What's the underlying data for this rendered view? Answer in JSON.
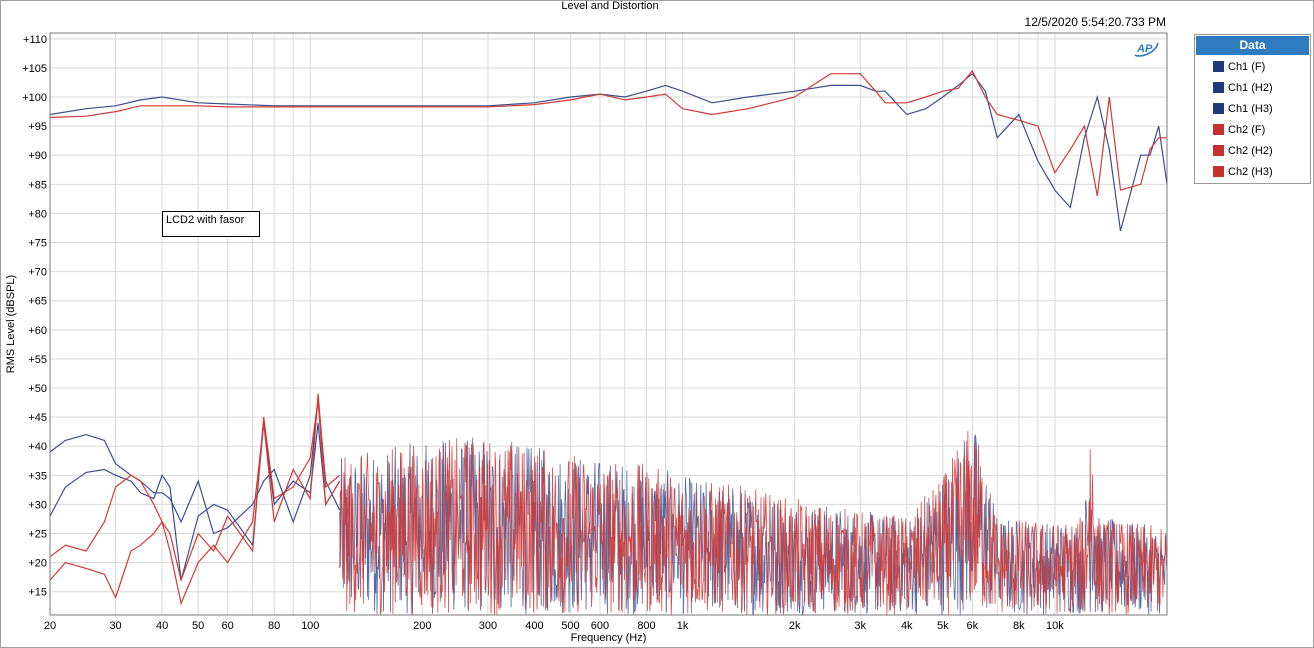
{
  "title": "Level and Distortion",
  "timestamp": "12/5/2020 5:54:20.733 PM",
  "logo_text": "AP",
  "annotation": "LCD2 with fasor",
  "legend": {
    "header": "Data",
    "items": [
      {
        "label": "Ch1 (F)",
        "color": "#1f3a7a"
      },
      {
        "label": "Ch1 (H2)",
        "color": "#1f3a7a"
      },
      {
        "label": "Ch1 (H3)",
        "color": "#1f3a7a"
      },
      {
        "label": "Ch2 (F)",
        "color": "#c8302e"
      },
      {
        "label": "Ch2 (H2)",
        "color": "#c8302e"
      },
      {
        "label": "Ch2 (H3)",
        "color": "#c8302e"
      }
    ]
  },
  "colors": {
    "ch1": "#3b4f8f",
    "ch2": "#d03a37",
    "grid": "#d8d8d8",
    "accent": "#2e7cbf"
  },
  "chart_data": {
    "type": "line",
    "xlabel": "Frequency (Hz)",
    "ylabel": "RMS Level (dBSPL)",
    "x_scale": "log",
    "xlim": [
      20,
      20000
    ],
    "ylim": [
      11,
      111
    ],
    "grid": true,
    "legend_position": "right",
    "x_ticks": [
      {
        "v": 20,
        "label": "20"
      },
      {
        "v": 30,
        "label": "30"
      },
      {
        "v": 40,
        "label": "40"
      },
      {
        "v": 50,
        "label": "50"
      },
      {
        "v": 60,
        "label": "60"
      },
      {
        "v": 80,
        "label": "80"
      },
      {
        "v": 100,
        "label": "100"
      },
      {
        "v": 200,
        "label": "200"
      },
      {
        "v": 300,
        "label": "300"
      },
      {
        "v": 400,
        "label": "400"
      },
      {
        "v": 500,
        "label": "500"
      },
      {
        "v": 600,
        "label": "600"
      },
      {
        "v": 800,
        "label": "800"
      },
      {
        "v": 1000,
        "label": "1k"
      },
      {
        "v": 2000,
        "label": "2k"
      },
      {
        "v": 3000,
        "label": "3k"
      },
      {
        "v": 4000,
        "label": "4k"
      },
      {
        "v": 5000,
        "label": "5k"
      },
      {
        "v": 6000,
        "label": "6k"
      },
      {
        "v": 8000,
        "label": "8k"
      },
      {
        "v": 10000,
        "label": "10k"
      }
    ],
    "y_ticks": [
      {
        "v": 110,
        "label": "+110"
      },
      {
        "v": 105,
        "label": "+105"
      },
      {
        "v": 100,
        "label": "+100"
      },
      {
        "v": 95,
        "label": "+95"
      },
      {
        "v": 90,
        "label": "+90"
      },
      {
        "v": 85,
        "label": "+85"
      },
      {
        "v": 80,
        "label": "+80"
      },
      {
        "v": 75,
        "label": "+75"
      },
      {
        "v": 70,
        "label": "+70"
      },
      {
        "v": 65,
        "label": "+65"
      },
      {
        "v": 60,
        "label": "+60"
      },
      {
        "v": 55,
        "label": "+55"
      },
      {
        "v": 50,
        "label": "+50"
      },
      {
        "v": 45,
        "label": "+45"
      },
      {
        "v": 40,
        "label": "+40"
      },
      {
        "v": 35,
        "label": "+35"
      },
      {
        "v": 30,
        "label": "+30"
      },
      {
        "v": 25,
        "label": "+25"
      },
      {
        "v": 20,
        "label": "+20"
      },
      {
        "v": 15,
        "label": "+15"
      }
    ],
    "series": [
      {
        "name": "Ch1 (F)",
        "color": "#3b4f8f",
        "x": [
          20,
          25,
          30,
          35,
          40,
          50,
          60,
          80,
          100,
          150,
          200,
          300,
          400,
          500,
          600,
          700,
          800,
          900,
          1000,
          1200,
          1500,
          2000,
          2500,
          3000,
          3300,
          3500,
          4000,
          4500,
          5000,
          5500,
          6000,
          6500,
          7000,
          8000,
          9000,
          10000,
          11000,
          12000,
          13000,
          14000,
          15000,
          17000,
          18000,
          19000,
          20000
        ],
        "y": [
          97,
          98,
          98.5,
          99.5,
          100,
          99,
          98.8,
          98.5,
          98.5,
          98.5,
          98.5,
          98.5,
          99,
          100,
          100.5,
          100,
          101,
          102,
          101,
          99,
          100,
          101,
          102,
          102,
          101,
          101,
          97,
          98,
          100,
          102,
          104,
          101,
          93,
          97,
          89,
          84,
          81,
          93,
          100,
          91,
          77,
          90,
          90,
          95,
          85
        ]
      },
      {
        "name": "Ch2 (F)",
        "color": "#d03a37",
        "x": [
          20,
          25,
          30,
          35,
          40,
          50,
          60,
          80,
          100,
          150,
          200,
          300,
          400,
          500,
          600,
          700,
          800,
          900,
          1000,
          1200,
          1500,
          2000,
          2500,
          3000,
          3300,
          3500,
          4000,
          4500,
          5000,
          5500,
          6000,
          6500,
          7000,
          8000,
          9000,
          10000,
          11000,
          12000,
          13000,
          14000,
          15000,
          17000,
          18000,
          19000,
          20000
        ],
        "y": [
          96.5,
          96.7,
          97.5,
          98.5,
          98.5,
          98.5,
          98.3,
          98.3,
          98.3,
          98.3,
          98.3,
          98.3,
          98.7,
          99.5,
          100.5,
          99.5,
          100,
          100.5,
          98,
          97,
          98,
          100,
          104,
          104,
          101,
          99,
          99,
          100,
          101,
          101.5,
          104.5,
          100,
          97,
          96,
          95,
          87,
          91,
          95,
          83,
          100,
          84,
          85,
          91,
          93,
          93
        ]
      },
      {
        "name": "Ch1 (H2)",
        "color": "#3b4f8f",
        "x": [
          20,
          22,
          25,
          28,
          30,
          33,
          35,
          38,
          40,
          42,
          45,
          50,
          55,
          60,
          70,
          75,
          80,
          90,
          100,
          105,
          110,
          120
        ],
        "y": [
          28,
          33,
          35.5,
          36,
          35,
          34,
          32,
          31,
          35,
          33,
          17,
          28,
          30,
          29,
          23,
          44,
          30,
          34,
          32,
          44,
          30,
          34
        ]
      },
      {
        "name": "Ch1 (H3)",
        "color": "#3b4f8f",
        "x": [
          20,
          22,
          25,
          28,
          30,
          33,
          35,
          38,
          40,
          42,
          45,
          50,
          55,
          60,
          70,
          75,
          80,
          90,
          100,
          105,
          110,
          120
        ],
        "y": [
          39,
          41,
          42,
          41,
          37,
          35,
          34,
          32,
          32,
          31,
          27,
          34,
          25,
          26,
          30,
          34,
          36,
          27,
          35,
          48,
          34,
          29
        ]
      },
      {
        "name": "Ch2 (H2)",
        "color": "#d03a37",
        "x": [
          20,
          22,
          25,
          28,
          30,
          33,
          35,
          38,
          40,
          42,
          45,
          50,
          55,
          60,
          70,
          75,
          80,
          90,
          100,
          105,
          110,
          120
        ],
        "y": [
          21,
          23,
          22,
          27,
          33,
          35,
          34,
          30,
          27,
          25,
          17,
          25,
          22,
          28,
          22,
          45,
          31,
          33,
          38,
          48,
          30,
          34
        ]
      },
      {
        "name": "Ch2 (H3)",
        "color": "#d03a37",
        "x": [
          20,
          22,
          25,
          28,
          30,
          33,
          35,
          38,
          40,
          42,
          45,
          50,
          55,
          60,
          70,
          75,
          80,
          90,
          100,
          105,
          110,
          120
        ],
        "y": [
          17,
          20,
          19,
          18,
          14,
          22,
          23,
          25,
          27,
          22,
          13,
          20,
          23,
          20,
          27,
          44,
          27,
          36,
          31,
          49,
          33,
          35
        ]
      }
    ],
    "noise_floor": {
      "note_points": "upper envelope of the dense harmonic noise band beyond 120 Hz",
      "x": [
        120,
        200,
        300,
        400,
        500,
        600,
        800,
        1000,
        1500,
        2000,
        3000,
        4000,
        5000,
        5500,
        6000,
        6500,
        7000,
        10000,
        12000,
        12500,
        13000,
        16000,
        20000
      ],
      "y": [
        38,
        41,
        42,
        40,
        39,
        38,
        37,
        35,
        33,
        31,
        29,
        28,
        35,
        40,
        45,
        37,
        28,
        27,
        28,
        51,
        28,
        27,
        26
      ]
    }
  }
}
